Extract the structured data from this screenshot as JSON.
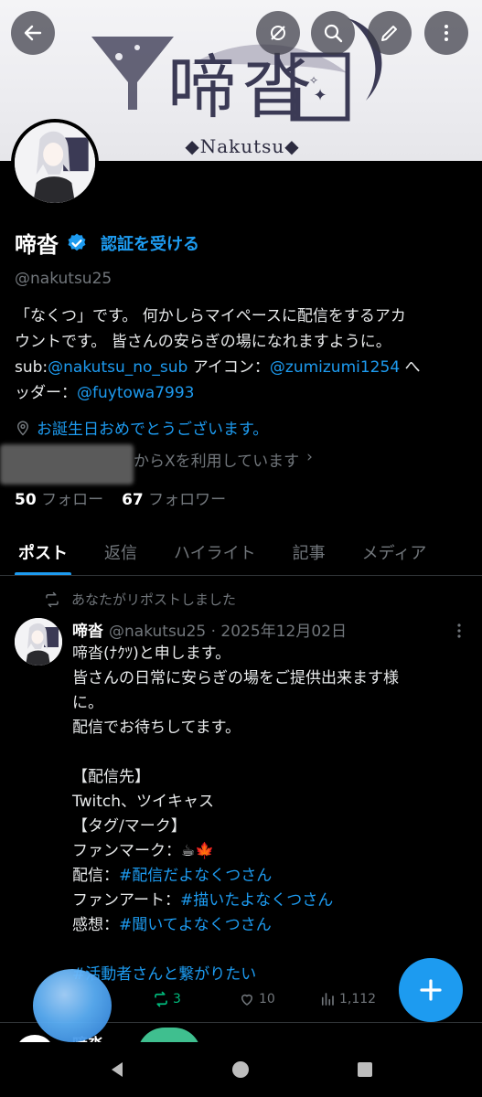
{
  "header": {
    "banner_logo": "啼沓",
    "banner_sub": "◆Nakutsu◆",
    "buttons": [
      "back-icon",
      "mute-icon",
      "search-icon",
      "edit-icon",
      "more-vertical-icon"
    ]
  },
  "profile": {
    "display_name": "啼沓",
    "verified_cta": "認証を受ける",
    "handle": "@nakutsu25",
    "bio": {
      "line1": "「なくつ」です。 何かしらマイペースに配信をするアカ",
      "line2": "ウントです。 皆さんの安らぎの場になれますように。",
      "line3_prefix": "sub:",
      "line3_link1": "@nakutsu_no_sub",
      "line3_mid": " アイコン：",
      "line3_link2": "@zumizumi1254",
      "line3_suffix": " へ",
      "line4_prefix": "ッダー：",
      "line4_link": "@fuytowa7993"
    },
    "birthday_text": "お誕生日おめでとうございます。",
    "joined_text": "からXを利用しています",
    "following_count": "50",
    "following_label": "フォロー",
    "followers_count": "67",
    "followers_label": "フォロワー"
  },
  "tabs": [
    {
      "label": "ポスト",
      "active": true
    },
    {
      "label": "返信",
      "active": false
    },
    {
      "label": "ハイライト",
      "active": false
    },
    {
      "label": "記事",
      "active": false
    },
    {
      "label": "メディア",
      "active": false
    }
  ],
  "post": {
    "repost_label": "あなたがリポストしました",
    "author_name": "啼沓",
    "author_meta": "@nakutsu25 · 2025年12月02日",
    "lines": [
      {
        "text": "啼沓(ﾅｸﾂ)と申します。"
      },
      {
        "text": "皆さんの日常に安らぎの場をご提供出来ます様"
      },
      {
        "text": "に。"
      },
      {
        "text": "配信でお待ちしてます。"
      },
      {
        "text": ""
      },
      {
        "text": "【配信先】"
      },
      {
        "text": "Twitch、ツイキャス"
      },
      {
        "text": "【タグ/マーク】"
      },
      {
        "text": "ファンマーク：☕🍁"
      },
      {
        "prefix": "配信：",
        "link": "#配信だよなくつさん"
      },
      {
        "prefix": "ファンアート：",
        "link": "#描いたよなくつさん"
      },
      {
        "prefix": "感想：",
        "link": "#聞いてよなくつさん"
      },
      {
        "text": ""
      },
      {
        "link": "#活動者さんと繋がりたい"
      }
    ],
    "repost_count": "3",
    "like_count": "10",
    "view_count": "1,112"
  },
  "next_post": {
    "author_name": "啼沓"
  },
  "colors": {
    "accent": "#1d9bf0",
    "repost_green": "#00ba7c",
    "muted": "#71767b"
  }
}
